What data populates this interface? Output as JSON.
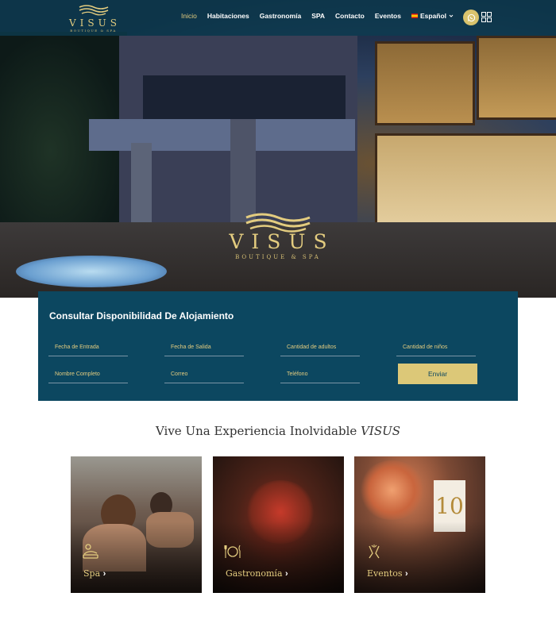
{
  "brand": {
    "name": "VISUS",
    "tagline": "BOUTIQUE & SPA"
  },
  "nav": {
    "items": [
      {
        "label": "Inicio",
        "active": true
      },
      {
        "label": "Habitaciones"
      },
      {
        "label": "Gastronomía"
      },
      {
        "label": "SPA"
      },
      {
        "label": "Contacto"
      },
      {
        "label": "Eventos"
      }
    ],
    "language": "Español",
    "icons": [
      "whatsapp-icon",
      "grid-menu-icon"
    ]
  },
  "booking": {
    "title": "Consultar Disponibilidad De Alojamiento",
    "fields": {
      "checkin": "Fecha de Entrada",
      "checkout": "Fecha de Salida",
      "adults": "Cantidad de adultos",
      "children": "Cantidad de niños",
      "name": "Nombre Completo",
      "email": "Correo",
      "phone": "Teléfono"
    },
    "submit": "Enviar"
  },
  "experience": {
    "title": "Vive Una Experiencia Inolvidable",
    "title_brand": "VISUS",
    "cards": [
      {
        "label": "Spa",
        "icon": "massage-icon"
      },
      {
        "label": "Gastronomía",
        "icon": "dining-icon"
      },
      {
        "label": "Eventos",
        "icon": "event-icon"
      }
    ],
    "table_number": "10"
  },
  "colors": {
    "primary": "#0c4760",
    "gold": "#e3cc7f",
    "button": "#dcc878"
  }
}
